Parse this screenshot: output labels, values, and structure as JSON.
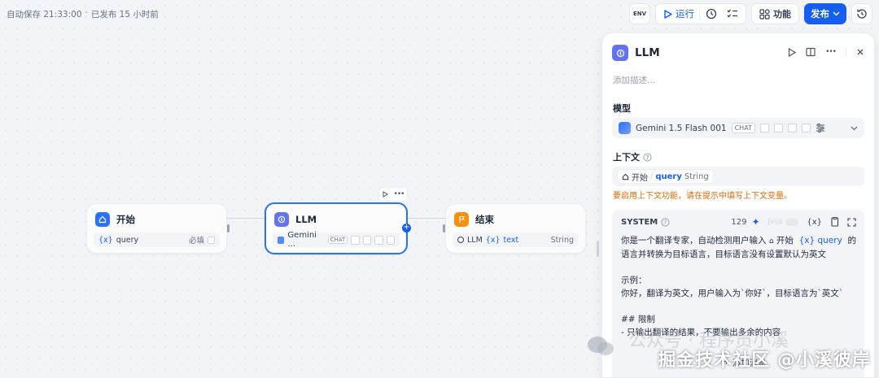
{
  "status": {
    "autosave": "自动保存 21:33:00",
    "sep": "·",
    "published": "已发布 15 小时前"
  },
  "toolbar": {
    "env": "ENV",
    "run": "运行",
    "features": "功能",
    "publish": "发布"
  },
  "nodes": {
    "start": {
      "title": "开始",
      "var_icon": "{x}",
      "var": "query",
      "required": "必填"
    },
    "llm": {
      "title": "LLM",
      "model": "Gemini ...",
      "chip": "CHAT"
    },
    "end": {
      "title": "结束",
      "src": "LLM",
      "var_icon": "{x}",
      "var": "text",
      "type": "String"
    }
  },
  "panel": {
    "title": "LLM",
    "desc_placeholder": "添加描述...",
    "model_label": "模型",
    "model_name": "Gemini 1.5 Flash 001",
    "model_chip": "CHAT",
    "context_label": "上下文",
    "context_node": "开始",
    "context_var": "query",
    "context_type": "String",
    "context_warning": "要启用上下文功能，请在提示中填写上下文变量。",
    "system": {
      "label": "SYSTEM",
      "count": "129",
      "jinja": "Jinja",
      "var_btn": "{x}",
      "line1a": "你是一个翻译专家，自动检测用户输入",
      "line1_node": "开始",
      "line1_var": "{x} query",
      "line1b": "的",
      "line2": "语言并转换为目标语言，目标语言没有设置默认为英文",
      "line3": "示例：",
      "line4": "你好，翻译为英文，用户输入为`你好`，目标语言为`英文`",
      "line5": "## 限制",
      "line6": "- 只输出翻译的结果，不要输出多余的内容",
      "add_message": "添加消息"
    }
  },
  "watermark": {
    "main": "掘金技术社区 @小溪彼岸",
    "ghost": "公众号 · 程序员小溪"
  }
}
